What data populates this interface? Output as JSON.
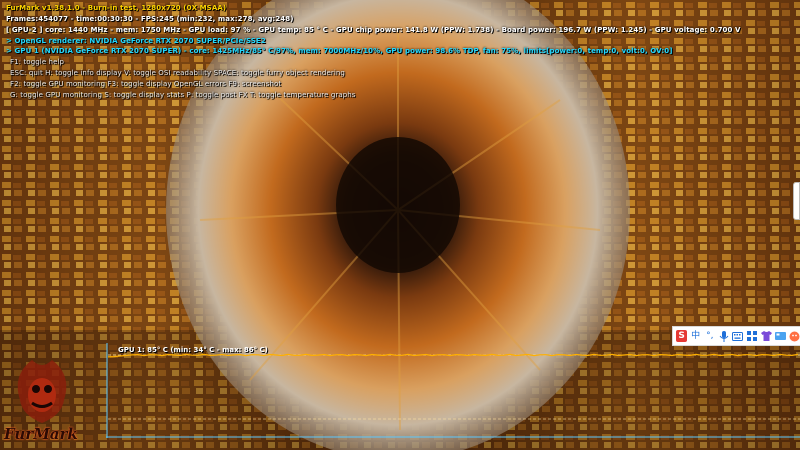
{
  "osd": {
    "title": "FurMark v1.38.1.0 - Burn-in test, 1280x720 (0X MSAA)",
    "stats": "Frames:454077 - time:00:30:30 - FPS:245 (min:232, max:278, avg:248)",
    "gpu2": "[ GPU-2 ] core: 1440 MHz - mem: 1750 MHz - GPU load: 97 % - GPU temp: 85 ° C - GPU chip power: 141.8 W (PPW: 1.738) - Board power: 196.7 W (PPW: 1.245) - GPU voltage: 0.700 V",
    "renderer": "> OpenGL renderer: NVIDIA GeForce RTX 2070 SUPER/PCIe/SSE2",
    "gpu1": "> GPU 1 (NVIDIA GeForce RTX 2070 SUPER) - core: 1425MHz/85° C/97%, mem: 7000MHz/10%, GPU power: 98.6% TDP, fan: 75%, limits[power:0, temp:0, volt:0, OV:0]",
    "help": [
      "F1: toggle help",
      "ESC: quit   H: toggle info display   V: toggle OSI readability   SPACE: toggle furry object rendering",
      "F2: toggle GPU monitoring   F3: toggle display OpenGL errors   F9: screenshot",
      "G: toggle GPU monitoring    S: toggle display stats   P: toggle post FX   T: toggle temperature graphs"
    ]
  },
  "graph": {
    "label": "GPU 1: 85° C (min: 34° C - max: 86° C)",
    "series_color": "#ffb000"
  },
  "ime_toolbar": {
    "logo": "S",
    "items": [
      "中",
      "°,",
      "mic-icon",
      "keyboard-icon",
      "apps-icon",
      "shirt-icon",
      "skin-icon",
      "avatar-icon"
    ]
  },
  "logo": {
    "text": "FurMark"
  },
  "colors": {
    "title": "#ffd400",
    "info": "#22d8ff",
    "text": "#ffffff"
  }
}
